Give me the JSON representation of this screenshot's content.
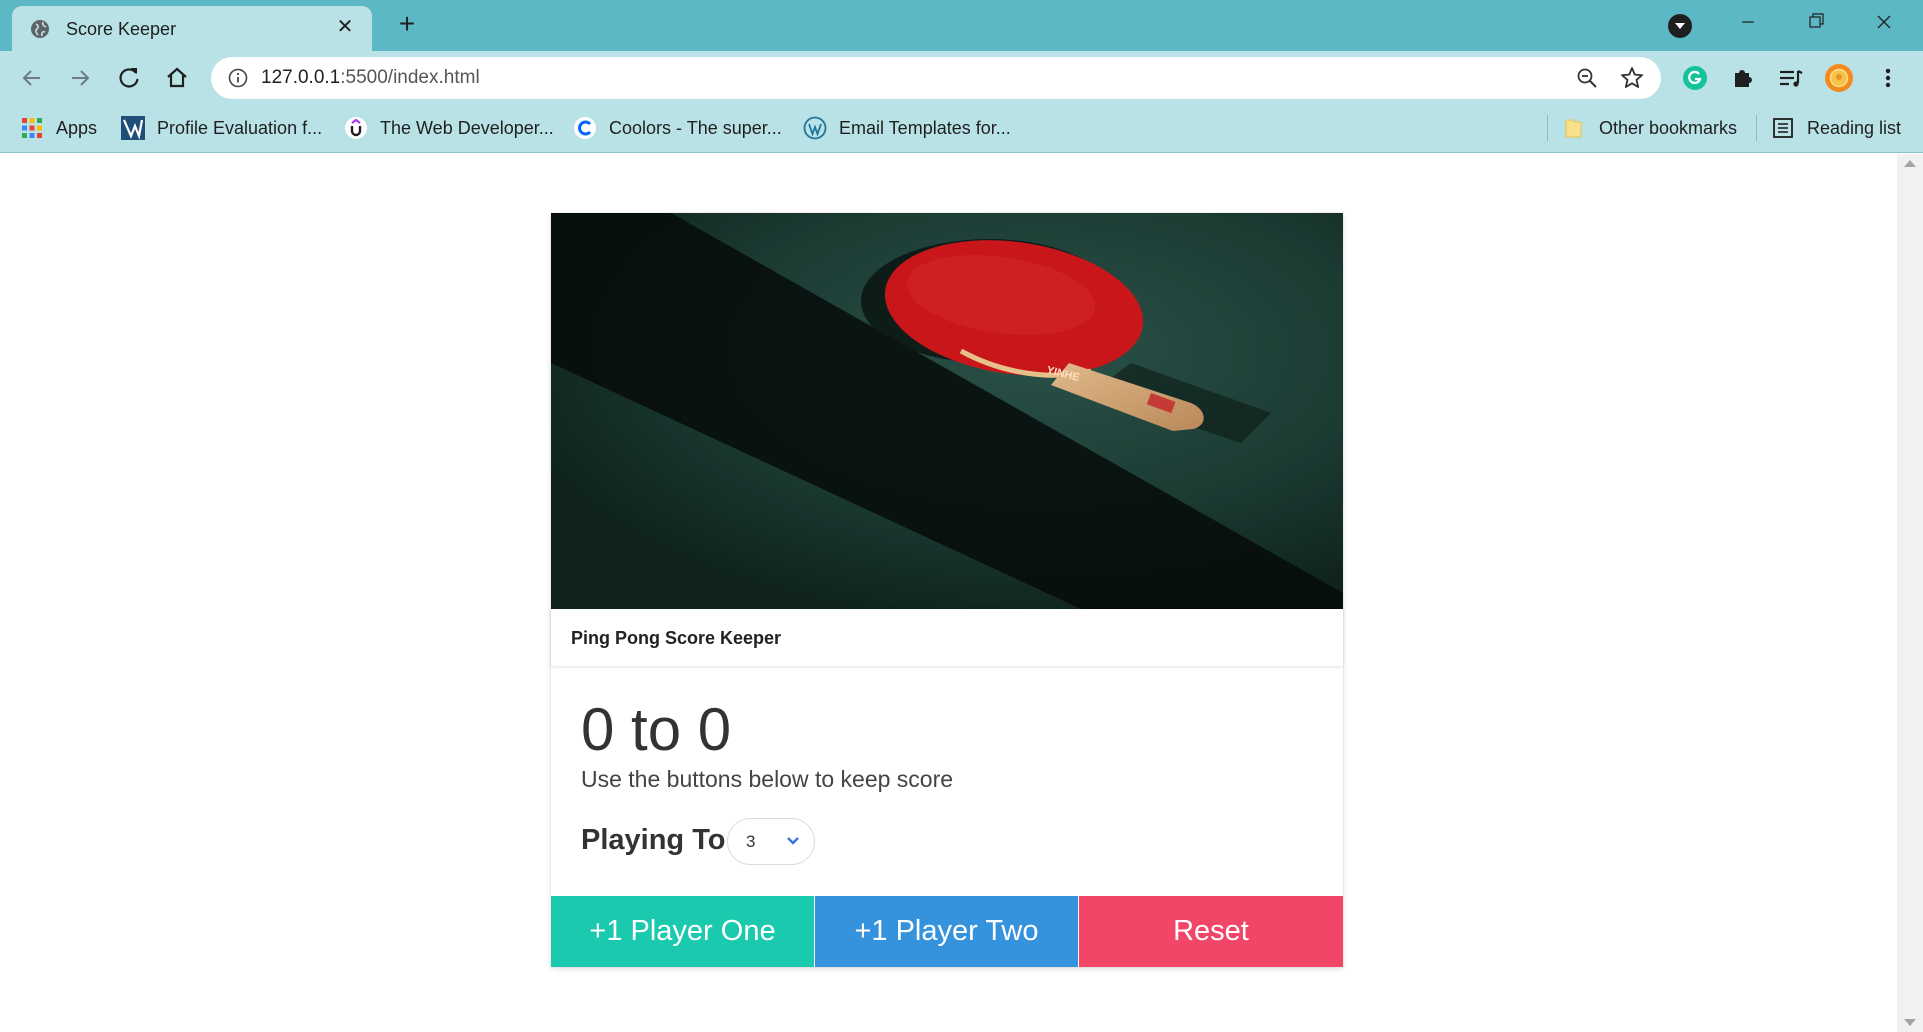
{
  "browser": {
    "tab_title": "Score Keeper",
    "url_host": "127.0.0.1",
    "url_path": ":5500/index.html",
    "bookmarks": [
      {
        "label": "Apps",
        "icon": "apps-grid-icon"
      },
      {
        "label": "Profile Evaluation f...",
        "icon": "v-logo-icon"
      },
      {
        "label": "The Web Developer...",
        "icon": "udemy-icon"
      },
      {
        "label": "Coolors - The super...",
        "icon": "coolors-icon"
      },
      {
        "label": "Email Templates for...",
        "icon": "wordpress-icon"
      }
    ],
    "other_bookmarks": "Other bookmarks",
    "reading_list": "Reading list"
  },
  "app": {
    "card_title": "Ping Pong Score Keeper",
    "score": "0 to 0",
    "subtitle": "Use the buttons below to keep score",
    "playing_to_label": "Playing To",
    "playing_to_value": "3",
    "buttons": {
      "player_one": "+1 Player One",
      "player_two": "+1 Player Two",
      "reset": "Reset"
    },
    "colors": {
      "player_one": "#1ac9ae",
      "player_two": "#3592dc",
      "reset": "#f14668",
      "paddle": "#c8161b",
      "table": "#1c3b33"
    }
  }
}
